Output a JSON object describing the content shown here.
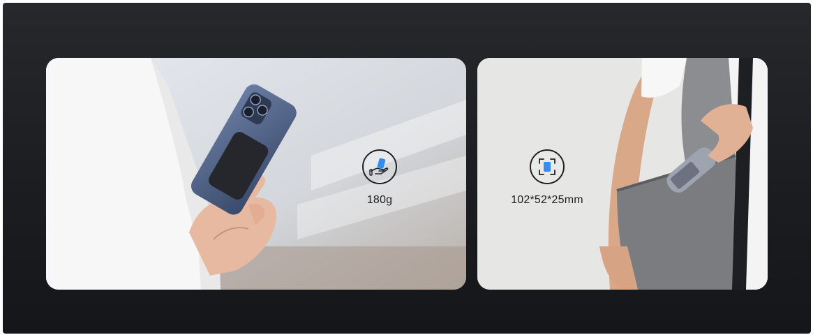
{
  "features": {
    "weight": {
      "label": "180g",
      "icon": "hand-holding-device-icon"
    },
    "size": {
      "label": "102*52*25mm",
      "icon": "dimension-frame-icon"
    }
  },
  "colors": {
    "background": "#1b1d21",
    "accent": "#2f8df5",
    "text": "#1c1e22"
  }
}
